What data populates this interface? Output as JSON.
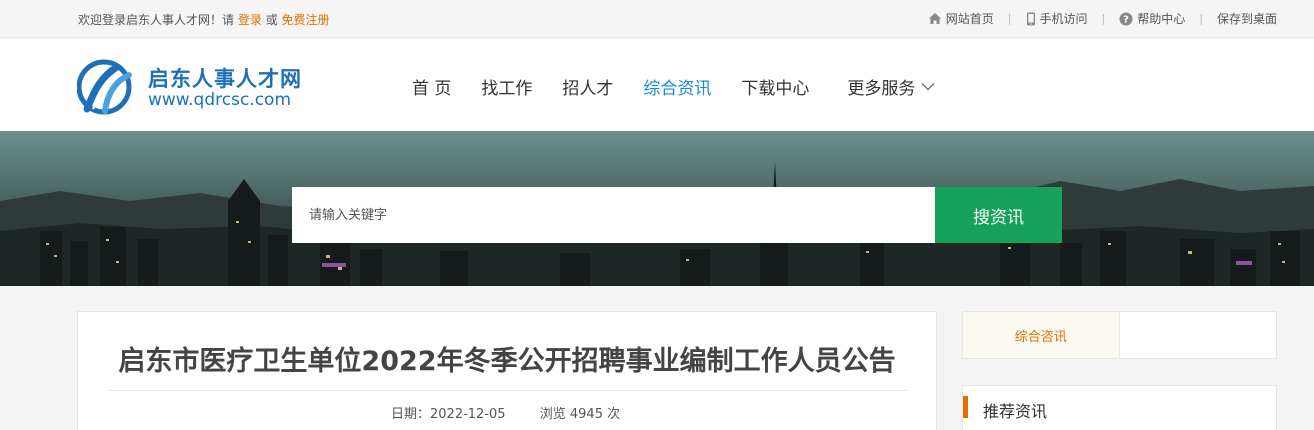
{
  "topbar": {
    "welcome_prefix": "欢迎登录启东人事人才网！请",
    "login": "登录",
    "or": "或",
    "register": "免费注册",
    "links": {
      "home": "网站首页",
      "mobile": "手机访问",
      "help": "帮助中心",
      "save": "保存到桌面"
    }
  },
  "header": {
    "logo_name": "启东人事人才网",
    "logo_url": "www.qdrcsc.com",
    "nav": {
      "home": "首 页",
      "jobs": "找工作",
      "recruit": "招人才",
      "news": "综合资讯",
      "download": "下载中心",
      "more": "更多服务"
    }
  },
  "search": {
    "placeholder": "请输入关键字",
    "button": "搜资讯"
  },
  "article": {
    "title": "启东市医疗卫生单位2022年冬季公开招聘事业编制工作人员公告",
    "date_label": "日期：",
    "date": "2022-12-05",
    "views_label": "浏览",
    "views": "4945",
    "views_unit": "次"
  },
  "sidebar": {
    "tab_active": "综合咨讯",
    "recommend_title": "推荐资讯"
  },
  "colors": {
    "accent_orange": "#e07000",
    "nav_active_blue": "#1a8bd6",
    "search_button_green": "#16a25a",
    "logo_blue": "#1f6fb8"
  }
}
